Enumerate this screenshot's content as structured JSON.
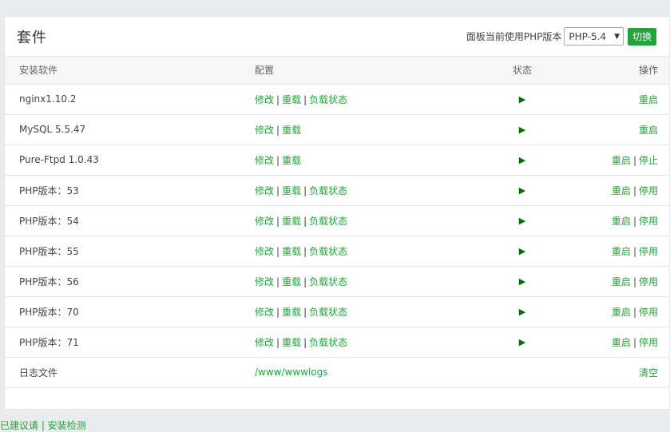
{
  "header": {
    "title": "套件",
    "php_label": "面板当前使用PHP版本",
    "php_selected": "PHP-5.4",
    "switch_btn": "切换"
  },
  "columns": {
    "name": "安装软件",
    "config": "配置",
    "status": "状态",
    "ops": "操作"
  },
  "rows": [
    {
      "name": "nginx1.10.2",
      "config": [
        "修改",
        "重载",
        "负载状态"
      ],
      "ops": [
        "重启"
      ]
    },
    {
      "name": "MySQL 5.5.47",
      "config": [
        "修改",
        "重载"
      ],
      "ops": [
        "重启"
      ]
    },
    {
      "name": "Pure-Ftpd 1.0.43",
      "config": [
        "修改",
        "重载"
      ],
      "ops": [
        "重启",
        "停止"
      ]
    },
    {
      "name": "PHP版本：53",
      "config": [
        "修改",
        "重载",
        "负载状态"
      ],
      "ops": [
        "重启",
        "停用"
      ]
    },
    {
      "name": "PHP版本：54",
      "config": [
        "修改",
        "重载",
        "负载状态"
      ],
      "ops": [
        "重启",
        "停用"
      ]
    },
    {
      "name": "PHP版本：55",
      "config": [
        "修改",
        "重载",
        "负载状态"
      ],
      "ops": [
        "重启",
        "停用"
      ]
    },
    {
      "name": "PHP版本：56",
      "config": [
        "修改",
        "重载",
        "负载状态"
      ],
      "ops": [
        "重启",
        "停用"
      ]
    },
    {
      "name": "PHP版本：70",
      "config": [
        "修改",
        "重载",
        "负载状态"
      ],
      "ops": [
        "重启",
        "停用"
      ]
    },
    {
      "name": "PHP版本：71",
      "config": [
        "修改",
        "重载",
        "负载状态"
      ],
      "ops": [
        "重启",
        "停用"
      ]
    }
  ],
  "logs": {
    "name": "日志文件",
    "path": "/www/wwwlogs",
    "clear": "清空"
  },
  "colors": {
    "accent": "#20a53a",
    "play": "#006f00"
  },
  "status_icon": "play-icon",
  "bottom_text": "已建议请 | 安装检测"
}
